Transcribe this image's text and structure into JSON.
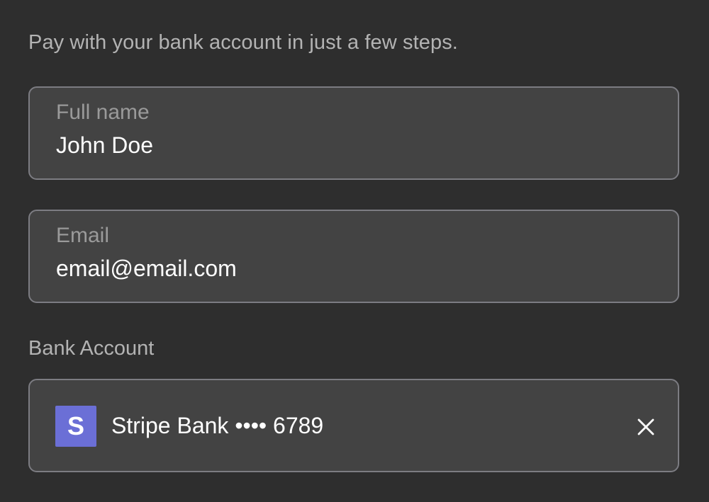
{
  "intro": {
    "text": "Pay with your bank account in just a few steps."
  },
  "form": {
    "full_name": {
      "label": "Full name",
      "value": "John Doe"
    },
    "email": {
      "label": "Email",
      "value": "email@email.com"
    }
  },
  "bank_account": {
    "section_label": "Bank Account",
    "logo_icon": "stripe-logo-icon",
    "logo_letter": "S",
    "display": "Stripe Bank •••• 6789",
    "remove_icon": "close-icon"
  },
  "colors": {
    "background": "#2e2e2e",
    "field_background": "#434343",
    "field_border": "#7c7c82",
    "brand": "#6b6fd6",
    "label_text": "#9a9a9a",
    "muted_text": "#b3b3b3",
    "value_text": "#ffffff"
  }
}
